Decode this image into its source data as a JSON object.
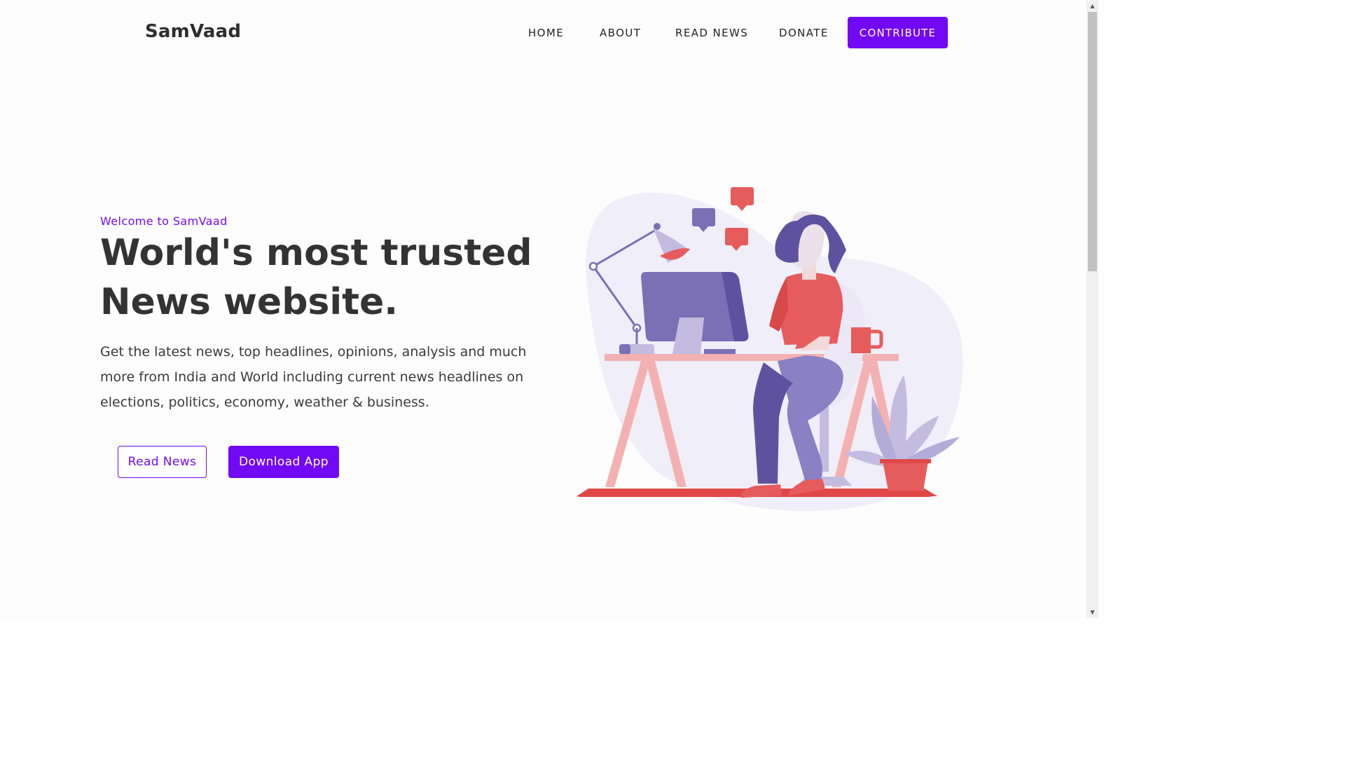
{
  "header": {
    "brand": "SamVaad",
    "nav": {
      "home": "HOME",
      "about": "ABOUT",
      "read_news": "READ NEWS",
      "donate": "DONATE",
      "contribute": "CONTRIBUTE"
    }
  },
  "hero": {
    "eyebrow": "Welcome to SamVaad",
    "headline_line1": "World's most trusted",
    "headline_line2": "News website.",
    "lead": "Get the latest news, top headlines, opinions, analysis and much more from India and World including current news headlines on elections, politics, economy, weather & business.",
    "read_news_label": "Read News",
    "download_label": "Download App",
    "illustration_icon": "woman-at-desk-illustration"
  },
  "colors": {
    "accent": "#7209f5",
    "text": "#333333",
    "illustration_purple": "#7b6fb6",
    "illustration_red": "#e65c5c",
    "illustration_pink": "#f4b1b1",
    "illustration_blob": "#f0eef8"
  },
  "scrollbar": {
    "up_icon": "scroll-up-arrow",
    "down_icon": "scroll-down-arrow"
  }
}
